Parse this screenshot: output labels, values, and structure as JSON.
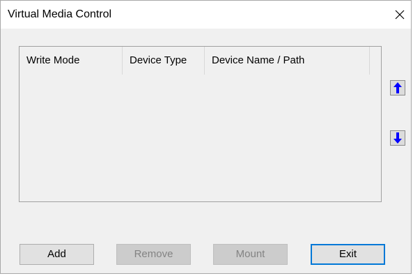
{
  "window": {
    "title": "Virtual Media Control",
    "close_icon": "close-icon"
  },
  "list": {
    "columns": [
      "Write Mode",
      "Device Type",
      "Device Name / Path"
    ],
    "rows": []
  },
  "side": {
    "up_icon": "arrow-up-icon",
    "down_icon": "arrow-down-icon",
    "arrow_color": "#0000ff"
  },
  "buttons": {
    "add": "Add",
    "remove": "Remove",
    "mount": "Mount",
    "exit": "Exit"
  },
  "colors": {
    "dialog_bg": "#f0f0f0",
    "default_button_border": "#0078d7"
  }
}
